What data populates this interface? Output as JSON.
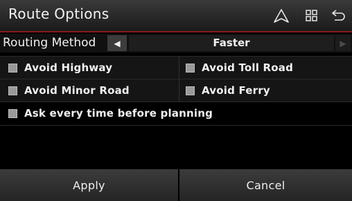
{
  "header": {
    "title": "Route Options",
    "icons": [
      "navigation-arrow-icon",
      "grid-menu-icon",
      "back-icon"
    ]
  },
  "routing": {
    "label": "Routing Method",
    "value": "Faster",
    "prev_glyph": "◀",
    "next_glyph": "▶"
  },
  "options": {
    "avoid_highway": "Avoid Highway",
    "avoid_toll_road": "Avoid Toll Road",
    "avoid_minor_road": "Avoid Minor Road",
    "avoid_ferry": "Avoid Ferry",
    "ask_every_time": "Ask every time before planning"
  },
  "footer": {
    "apply": "Apply",
    "cancel": "Cancel"
  },
  "colors": {
    "accent": "#8b1a1a"
  }
}
